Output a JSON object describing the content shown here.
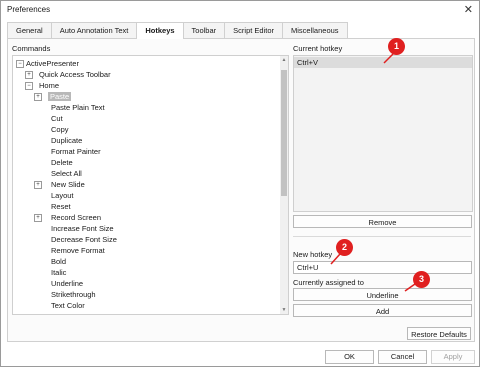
{
  "window": {
    "title": "Preferences"
  },
  "tabs": [
    {
      "label": "General"
    },
    {
      "label": "Auto Annotation Text"
    },
    {
      "label": "Hotkeys",
      "active": true
    },
    {
      "label": "Toolbar"
    },
    {
      "label": "Script Editor"
    },
    {
      "label": "Miscellaneous"
    }
  ],
  "commands": {
    "label": "Commands",
    "items": [
      {
        "label": "ActivePresenter",
        "expander": "−"
      },
      {
        "label": "Quick Access Toolbar",
        "expander": "+"
      },
      {
        "label": "Home",
        "expander": "−"
      },
      {
        "label": "Paste",
        "expander": "+",
        "selected": true
      },
      {
        "label": "Paste Plain Text"
      },
      {
        "label": "Cut"
      },
      {
        "label": "Copy"
      },
      {
        "label": "Duplicate"
      },
      {
        "label": "Format Painter"
      },
      {
        "label": "Delete"
      },
      {
        "label": "Select All"
      },
      {
        "label": "New Slide",
        "expander": "+"
      },
      {
        "label": "Layout"
      },
      {
        "label": "Reset"
      },
      {
        "label": "Record Screen",
        "expander": "+"
      },
      {
        "label": "Increase Font Size"
      },
      {
        "label": "Decrease Font Size"
      },
      {
        "label": "Remove Format"
      },
      {
        "label": "Bold"
      },
      {
        "label": "Italic"
      },
      {
        "label": "Underline"
      },
      {
        "label": "Strikethrough"
      },
      {
        "label": "Text Color"
      }
    ]
  },
  "current_hotkey": {
    "label": "Current hotkey",
    "value": "Ctrl+V",
    "remove_label": "Remove"
  },
  "new_hotkey": {
    "label": "New hotkey",
    "value": "Ctrl+U"
  },
  "assigned": {
    "label": "Currently assigned to",
    "value": "Underline"
  },
  "add_label": "Add",
  "restore_label": "Restore Defaults",
  "footer": {
    "ok": "OK",
    "cancel": "Cancel",
    "apply": "Apply"
  },
  "badges": [
    "1",
    "2",
    "3"
  ],
  "colors": {
    "badge": "#e02020",
    "selection": "#b8b8b8"
  }
}
